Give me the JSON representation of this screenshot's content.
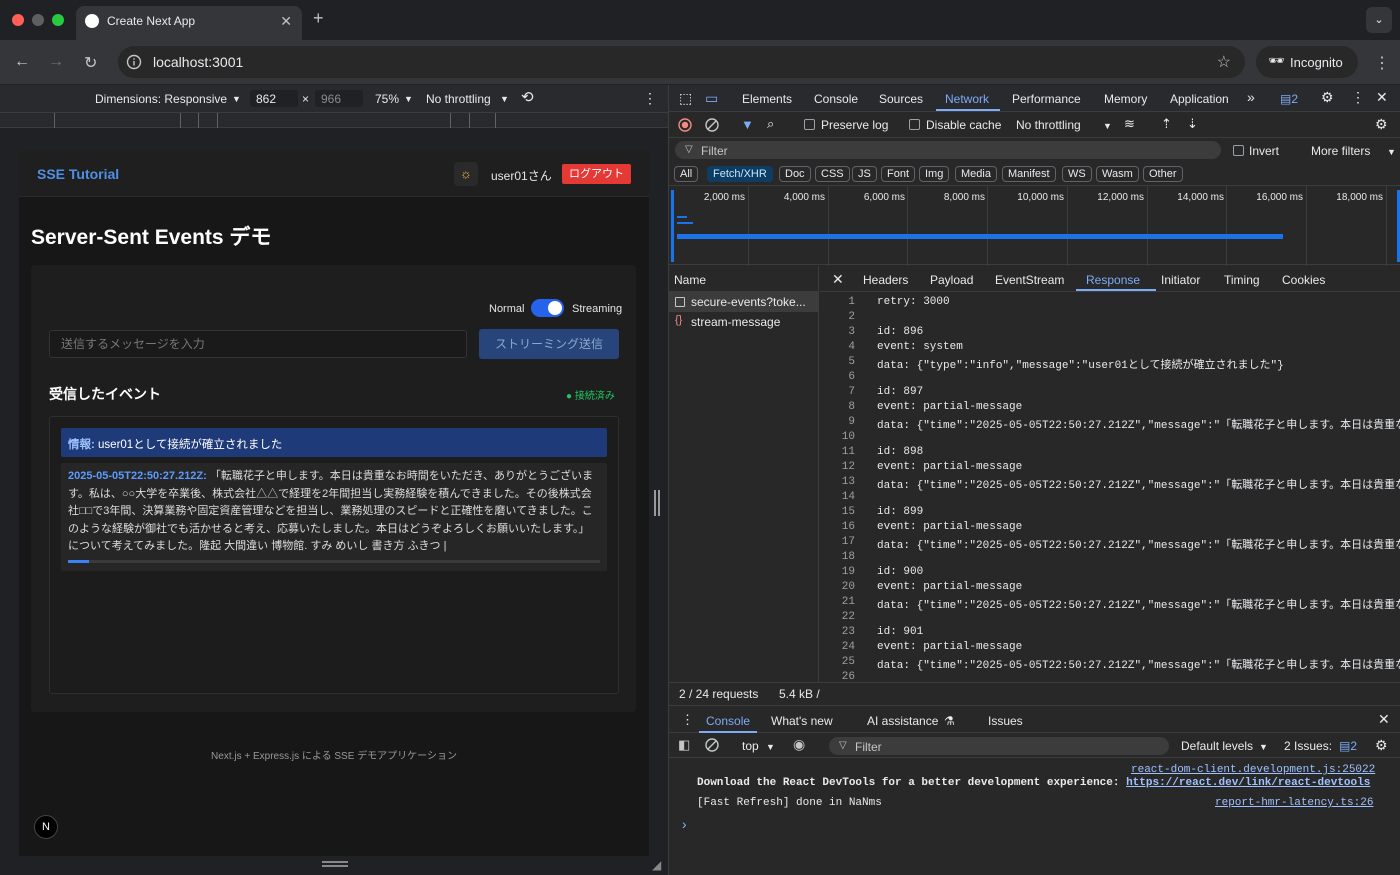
{
  "browser": {
    "tab_title": "Create Next App",
    "url": "localhost:3001",
    "incognito_label": "Incognito"
  },
  "device_toolbar": {
    "dimensions_label": "Dimensions: Responsive",
    "width": "862",
    "height": "966",
    "times": "×",
    "zoom": "75%",
    "throttling": "No throttling"
  },
  "app": {
    "brand": "SSE Tutorial",
    "username": "user01さん",
    "logout_label": "ログアウト",
    "page_title": "Server-Sent Events デモ",
    "mode_normal": "Normal",
    "mode_streaming": "Streaming",
    "message_placeholder": "送信するメッセージを入力",
    "send_label": "ストリーミング送信",
    "events_title": "受信したイベント",
    "status": "● 接続済み",
    "events": [
      {
        "prefix": "情報:",
        "text": " user01として接続が確立されました"
      },
      {
        "timestamp": "2025-05-05T22:50:27.212Z:",
        "text": " 「転職花子と申します。本日は貴重なお時間をいただき、ありがとうございます。私は、○○大学を卒業後、株式会社△△で経理を2年間担当し実務経験を積んできました。その後株式会社□□で3年間、決算業務や固定資産管理などを担当し、業務処理のスピードと正確性を磨いてきました。このような経験が御社でも活かせると考え、応募いたしました。本日はどうぞよろしくお願いいたします。」について考えてみました。隆起 大間違い 博物館. すみ めいし 書き方 ふきつ |"
      }
    ],
    "footer": "Next.js + Express.js による SSE デモアプリケーション",
    "next_logo": "N"
  },
  "devtools": {
    "tabs": [
      "Elements",
      "Console",
      "Sources",
      "Network",
      "Performance",
      "Memory",
      "Application"
    ],
    "more_tabs": "»",
    "issues_count": "2",
    "network": {
      "preserve_log": "Preserve log",
      "disable_cache": "Disable cache",
      "throttling": "No throttling",
      "filter_placeholder": "Filter",
      "invert": "Invert",
      "more_filters": "More filters",
      "types": [
        "All",
        "Fetch/XHR",
        "Doc",
        "CSS",
        "JS",
        "Font",
        "Img",
        "Media",
        "Manifest",
        "WS",
        "Wasm",
        "Other"
      ],
      "timeline_ticks": [
        "2,000 ms",
        "4,000 ms",
        "6,000 ms",
        "8,000 ms",
        "10,000 ms",
        "12,000 ms",
        "14,000 ms",
        "16,000 ms",
        "18,000 ms"
      ],
      "name_header": "Name",
      "requests": [
        "secure-events?toke...",
        "stream-message"
      ],
      "detail_tabs": [
        "Headers",
        "Payload",
        "EventStream",
        "Response",
        "Initiator",
        "Timing",
        "Cookies"
      ],
      "response_lines": [
        "retry: 3000",
        "",
        "id: 896",
        "event: system",
        "data: {\"type\":\"info\",\"message\":\"user01として接続が確立されました\"}",
        "",
        "id: 897",
        "event: partial-message",
        "data: {\"time\":\"2025-05-05T22:50:27.212Z\",\"message\":\"「転職花子と申します。本日は貴重なお",
        "",
        "id: 898",
        "event: partial-message",
        "data: {\"time\":\"2025-05-05T22:50:27.212Z\",\"message\":\"「転職花子と申します。本日は貴重なお",
        "",
        "id: 899",
        "event: partial-message",
        "data: {\"time\":\"2025-05-05T22:50:27.212Z\",\"message\":\"「転職花子と申します。本日は貴重なお",
        "",
        "id: 900",
        "event: partial-message",
        "data: {\"time\":\"2025-05-05T22:50:27.212Z\",\"message\":\"「転職花子と申します。本日は貴重なお",
        "",
        "id: 901",
        "event: partial-message",
        "data: {\"time\":\"2025-05-05T22:50:27.212Z\",\"message\":\"「転職花子と申します。本日は貴重なお",
        ""
      ],
      "summary_requests": "2 / 24 requests",
      "summary_size": "5.4 kB /"
    },
    "drawer": {
      "tabs": [
        "Console",
        "What's new",
        "AI assistance",
        "Issues"
      ],
      "context": "top",
      "filter_placeholder": "Filter",
      "levels": "Default levels",
      "issues_label": "2 Issues:",
      "issues_count": "2",
      "messages": [
        {
          "source": "react-dom-client.development.js:25022",
          "text": "Download the React DevTools for a better development experience: ",
          "link": "https://react.dev/link/react-devtools"
        },
        {
          "source": "report-hmr-latency.ts:26",
          "text": "[Fast Refresh] done in NaNms",
          "link": ""
        }
      ],
      "prompt": "›"
    }
  }
}
